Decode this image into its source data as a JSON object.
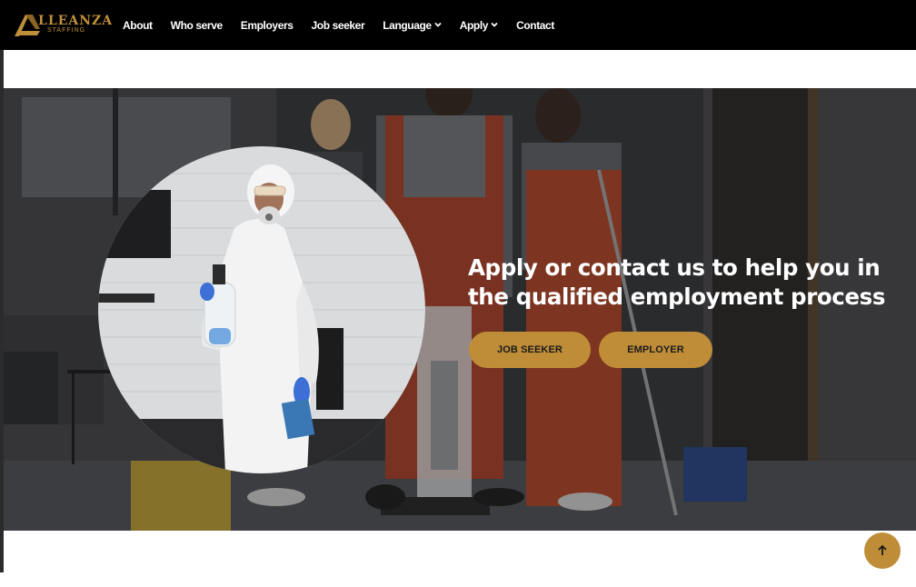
{
  "brand": {
    "name": "LLEANZA",
    "tagline": "STAFFING",
    "accent_color": "#bf8d38"
  },
  "nav": {
    "items": [
      {
        "label": "About",
        "has_dropdown": false
      },
      {
        "label": "Who serve",
        "has_dropdown": false
      },
      {
        "label": "Employers",
        "has_dropdown": false
      },
      {
        "label": "Job seeker",
        "has_dropdown": false
      },
      {
        "label": "Language",
        "has_dropdown": true
      },
      {
        "label": "Apply",
        "has_dropdown": true
      },
      {
        "label": "Contact",
        "has_dropdown": false
      }
    ]
  },
  "hero": {
    "headline_line1": "Apply or contact us to help you in",
    "headline_line2": "the qualified employment process",
    "buttons": {
      "job_seeker": "JOB SEEKER",
      "employer": "EMPLOYER"
    }
  },
  "icons": {
    "dropdown": "chevron-down-icon",
    "scroll_top": "arrow-up-icon"
  }
}
